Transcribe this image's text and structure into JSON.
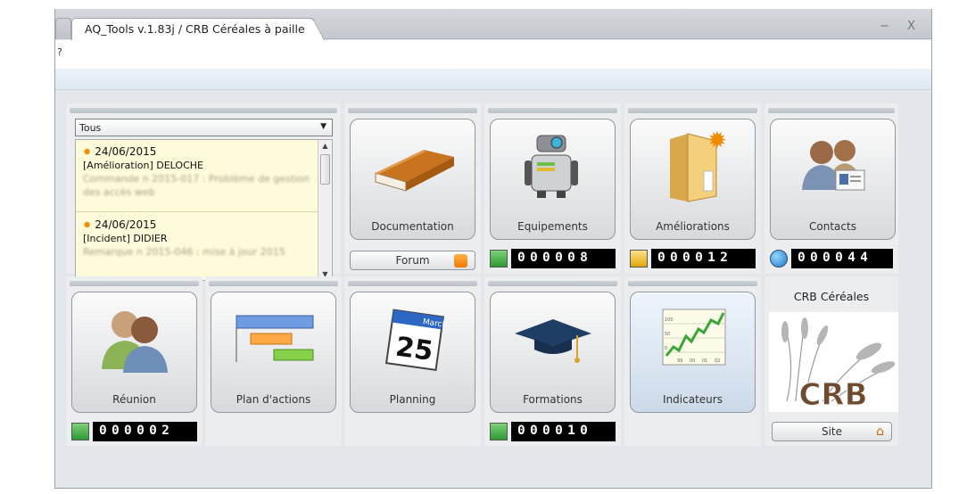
{
  "window": {
    "title": "AQ_Tools v.1.83j / CRB Céréales à paille",
    "minimize_glyph": "−",
    "close_glyph": "X"
  },
  "menu": {
    "help": "?"
  },
  "news": {
    "filter_value": "Tous",
    "items": [
      {
        "date": "24/06/2015",
        "title": "[Amélioration] DELOCHE",
        "detail": "Commande n 2015-017 : Problème de gestion des accès web"
      },
      {
        "date": "24/06/2015",
        "title": "[Incident] DIDIER",
        "detail": "Remarque n 2015-046 : mise à jour 2015"
      }
    ]
  },
  "tiles": {
    "documentation": {
      "label": "Documentation",
      "sub_button": "Forum"
    },
    "equipements": {
      "label": "Equipements",
      "count": "000008",
      "status": "green"
    },
    "ameliorations": {
      "label": "Améliorations",
      "count": "000012",
      "status": "yellow"
    },
    "contacts": {
      "label": "Contacts",
      "count": "000044",
      "status": "globe"
    },
    "reunion": {
      "label": "Réunion",
      "count": "000002",
      "status": "green"
    },
    "plan_actions": {
      "label": "Plan d'actions"
    },
    "planning": {
      "label": "Planning",
      "calendar_month": "March",
      "calendar_day": "25"
    },
    "formations": {
      "label": "Formations",
      "count": "000010",
      "status": "green"
    },
    "indicateurs": {
      "label": "Indicateurs",
      "axis_labels": [
        "100",
        "50",
        "0",
        "99",
        "00",
        "01",
        "02"
      ]
    },
    "crb": {
      "title": "CRB Céréales",
      "logo_text": "CRB",
      "site_button": "Site"
    }
  },
  "colors": {
    "accent_blue": "#dbe6f2",
    "led_green": "#2f9a35",
    "led_yellow": "#e0a60a",
    "note_bg": "#fdfbd9"
  }
}
